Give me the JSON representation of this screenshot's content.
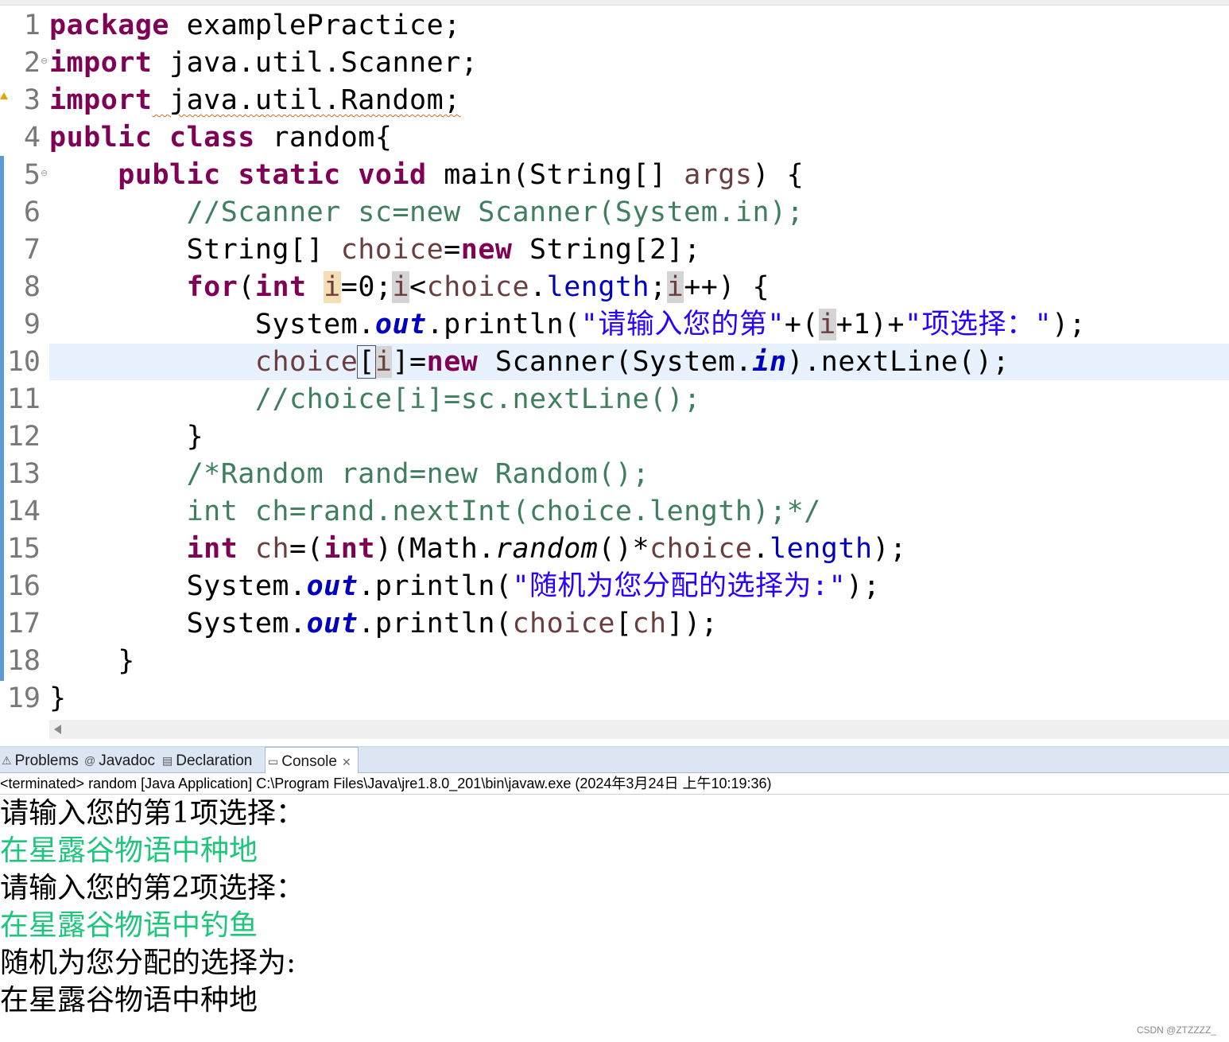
{
  "editor": {
    "line_numbers": [
      "1",
      "2",
      "3",
      "4",
      "5",
      "6",
      "7",
      "8",
      "9",
      "10",
      "11",
      "12",
      "13",
      "14",
      "15",
      "16",
      "17",
      "18",
      "19"
    ],
    "code": {
      "l1": {
        "kw": "package",
        "rest": " examplePractice;"
      },
      "l2": {
        "kw": "import",
        "rest": " java.util.Scanner;"
      },
      "l3": {
        "kw": "import",
        "rest": " java.util.Random;"
      },
      "l4": {
        "kw1": "public",
        "kw2": "class",
        "rest": " random{"
      },
      "l5": {
        "kw1": "public",
        "kw2": "static",
        "kw3": "void",
        "a": " main(String[] ",
        "var": "args",
        "b": ") {"
      },
      "l6": {
        "comment": "//Scanner sc=new Scanner(System.in);"
      },
      "l7": {
        "a": "String[] ",
        "var": "choice",
        "b": "=",
        "kw": "new",
        "c": " String[2];"
      },
      "l8": {
        "kw1": "for",
        "a": "(",
        "kw2": "int",
        "sp": " ",
        "i1": "i",
        "b": "=0;",
        "i2": "i",
        "c": "<",
        "var": "choice",
        "d": ".",
        "fld": "length",
        "e": ";",
        "i3": "i",
        "f": "++) {"
      },
      "l9": {
        "a": "System.",
        "out": "out",
        "b": ".println(",
        "s1": "\"请输入您的第\"",
        "c": "+(",
        "i": "i",
        "d": "+1)+",
        "s2": "\"项选择：\"",
        "e": ");"
      },
      "l10": {
        "var": "choice",
        "lb": "[",
        "i": "i",
        "rb": "]",
        "a": "=",
        "kw": "new",
        "b": " Scanner(System.",
        "in": "in",
        "c": ").nextLine();"
      },
      "l11": {
        "comment": "//choice[i]=sc.nextLine();"
      },
      "l12": {
        "a": "}"
      },
      "l13": {
        "comment": "/*Random rand=new Random();"
      },
      "l14": {
        "comment": "int ch=rand.nextInt(choice.length);*/"
      },
      "l15": {
        "kw1": "int",
        "sp": " ",
        "var1": "ch",
        "a": "=(",
        "kw2": "int",
        "b": ")(Math.",
        "fn": "random",
        "c": "()*",
        "var2": "choice",
        "d": ".",
        "fld": "length",
        "e": ");"
      },
      "l16": {
        "a": "System.",
        "out": "out",
        "b": ".println(",
        "s": "\"随机为您分配的选择为:\"",
        "c": ");"
      },
      "l17": {
        "a": "System.",
        "out": "out",
        "b": ".println(",
        "var1": "choice",
        "c": "[",
        "var2": "ch",
        "d": "]);"
      },
      "l18": {
        "a": "}"
      },
      "l19": {
        "a": "}"
      }
    }
  },
  "views": {
    "tabs": [
      {
        "label": "Problems",
        "icon": "problems-icon"
      },
      {
        "label": "Javadoc",
        "icon": "javadoc-icon"
      },
      {
        "label": "Declaration",
        "icon": "declaration-icon"
      },
      {
        "label": "Console",
        "icon": "console-icon",
        "active": true
      }
    ],
    "close_glyph": "✕"
  },
  "console": {
    "status": "<terminated> random [Java Application] C:\\Program Files\\Java\\jre1.8.0_201\\bin\\javaw.exe (2024年3月24日 上午10:19:36)",
    "lines": [
      {
        "text": "请输入您的第1项选择：",
        "kind": "output"
      },
      {
        "text": "在星露谷物语中种地",
        "kind": "input"
      },
      {
        "text": "请输入您的第2项选择：",
        "kind": "output"
      },
      {
        "text": "在星露谷物语中钓鱼",
        "kind": "input"
      },
      {
        "text": "随机为您分配的选择为:",
        "kind": "output"
      },
      {
        "text": "在星露谷物语中种地",
        "kind": "output"
      }
    ]
  },
  "colors": {
    "keyword": "#7f0055",
    "string": "#2a00ff",
    "comment": "#3f7f5f",
    "field": "#0000c0",
    "console_input": "#1cc67a"
  },
  "watermark": "CSDN @ZTZZZZ_"
}
